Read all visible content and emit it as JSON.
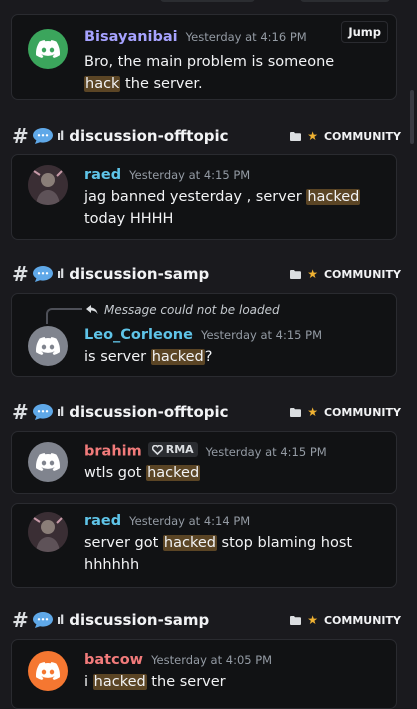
{
  "jump_label": "Jump",
  "results": [
    {
      "author": "Bisayanibai",
      "author_color": "#a6a2ff",
      "time": "Yesterday at 4:16 PM",
      "msg_before": "Bro, the main problem is someone ",
      "msg_hl": "hack",
      "msg_after": " the server.",
      "avatar_color": "#3ba55c"
    }
  ],
  "groups": [
    {
      "channel": "discussion-offtopic",
      "community": "COMMUNITY",
      "messages": [
        {
          "author": "raed",
          "author_color": "#5fc4e8",
          "time": "Yesterday at 4:15 PM",
          "msg_before": "jag banned yesterday , server ",
          "msg_hl": "hacked",
          "msg_after": " today HHHH"
        }
      ]
    },
    {
      "channel": "discussion-samp",
      "community": "COMMUNITY",
      "messages": [
        {
          "reply_text": "Message could not be loaded",
          "author": "Leo_Corleone",
          "author_color": "#5fc4e8",
          "time": "Yesterday at 4:15 PM",
          "msg_before": "is server ",
          "msg_hl": "hacked",
          "msg_after": "?",
          "avatar_color": "#80848e"
        }
      ]
    },
    {
      "channel": "discussion-offtopic",
      "community": "COMMUNITY",
      "messages": [
        {
          "author": "brahim",
          "author_color": "#f27b7b",
          "badge": "RMA",
          "time": "Yesterday at 4:15 PM",
          "msg_before": "wtls got ",
          "msg_hl": "hacked",
          "msg_after": "",
          "avatar_color": "#80848e"
        },
        {
          "author": "raed",
          "author_color": "#5fc4e8",
          "time": "Yesterday at 4:14 PM",
          "msg_before": "server got ",
          "msg_hl": "hacked",
          "msg_after": " stop blaming host hhhhhh"
        }
      ]
    },
    {
      "channel": "discussion-samp",
      "community": "COMMUNITY",
      "messages": [
        {
          "author": "batcow",
          "author_color": "#f27b7b",
          "time": "Yesterday at 4:05 PM",
          "msg_before": "i ",
          "msg_hl": "hacked",
          "msg_after": " the server",
          "avatar_color": "#f57731"
        }
      ]
    }
  ]
}
